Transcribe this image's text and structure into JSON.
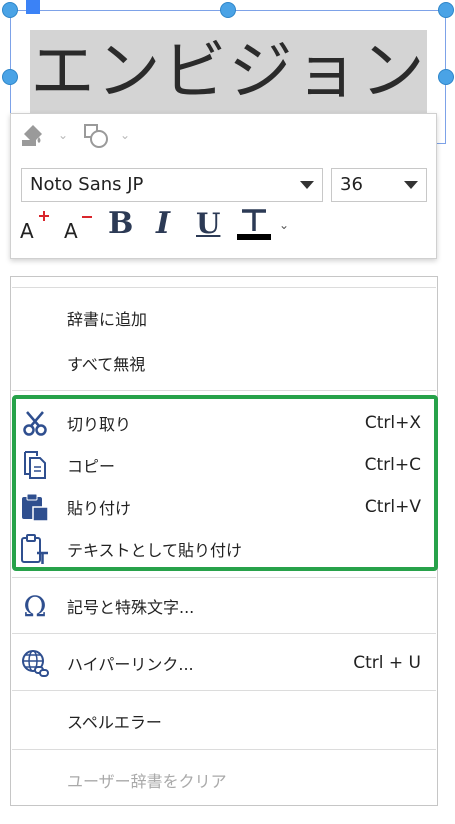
{
  "textbox": {
    "content": "エンビジョン"
  },
  "toolbar": {
    "fill_icon": "fill-bucket-icon",
    "shape_icon": "shape-style-icon",
    "font_family": "Noto Sans JP",
    "font_size": "36",
    "increase_font_icon": "increase-font-icon",
    "decrease_font_icon": "decrease-font-icon",
    "bold_label": "B",
    "italic_label": "I",
    "underline_label": "U",
    "font_color_label": "T",
    "font_color": "#000000",
    "accent_red": "#d9262c"
  },
  "menu": {
    "items": [
      {
        "label": "辞書に追加",
        "shortcut": "",
        "icon": "",
        "enabled": true
      },
      {
        "label": "すべて無視",
        "shortcut": "",
        "icon": "",
        "enabled": true
      },
      {
        "label": "切り取り",
        "shortcut": "Ctrl+X",
        "icon": "scissors-icon",
        "enabled": true
      },
      {
        "label": "コピー",
        "shortcut": "Ctrl+C",
        "icon": "copy-icon",
        "enabled": true
      },
      {
        "label": "貼り付け",
        "shortcut": "Ctrl+V",
        "icon": "paste-icon",
        "enabled": true
      },
      {
        "label": "テキストとして貼り付け",
        "shortcut": "",
        "icon": "paste-text-icon",
        "enabled": true
      },
      {
        "label": "記号と特殊文字...",
        "shortcut": "",
        "icon": "omega-icon",
        "enabled": true
      },
      {
        "label": "ハイパーリンク...",
        "shortcut": "Ctrl + U",
        "icon": "hyperlink-icon",
        "enabled": true
      },
      {
        "label": "スペルエラー",
        "shortcut": "",
        "icon": "",
        "enabled": true
      },
      {
        "label": "ユーザー辞書をクリア",
        "shortcut": "",
        "icon": "",
        "enabled": false
      }
    ]
  },
  "colors": {
    "selection_handle": "#4aa3e6",
    "highlight": "#27a24a",
    "icon_blue": "#2f4f8f"
  }
}
